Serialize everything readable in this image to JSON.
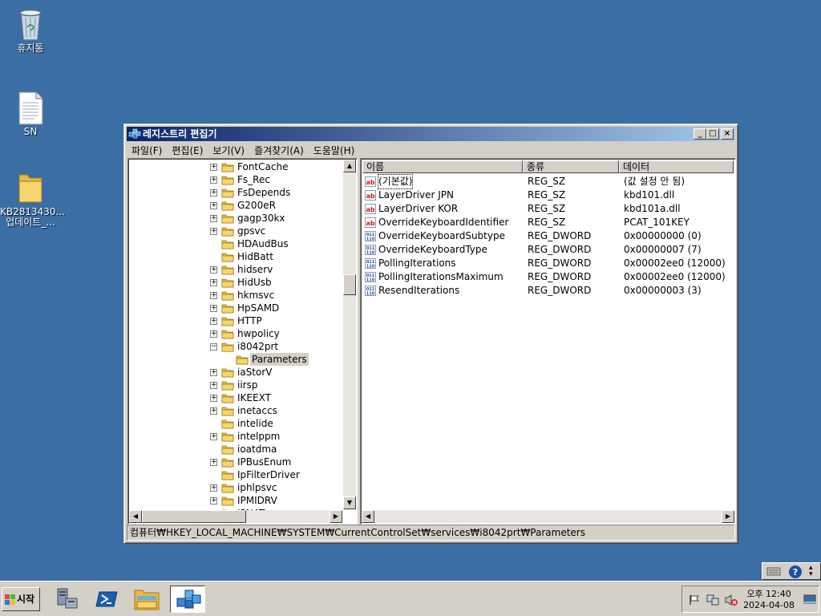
{
  "desktop": {
    "icons": [
      {
        "label": "휴지통",
        "icon": "recycle-bin-icon"
      },
      {
        "label": "SN",
        "icon": "text-file-icon"
      },
      {
        "label": "KB2813430...\n업데이트_...",
        "label1": "KB2813430...",
        "label2": "업데이트_...",
        "icon": "folder-icon"
      }
    ]
  },
  "window": {
    "title": "레지스트리 편집기",
    "menu": [
      "파일(F)",
      "편집(E)",
      "보기(V)",
      "즐겨찾기(A)",
      "도움말(H)"
    ]
  },
  "tree": {
    "items": [
      {
        "label": "FontCache",
        "expander": "+"
      },
      {
        "label": "Fs_Rec",
        "expander": "+"
      },
      {
        "label": "FsDepends",
        "expander": "+"
      },
      {
        "label": "G200eR",
        "expander": "+"
      },
      {
        "label": "gagp30kx",
        "expander": "+"
      },
      {
        "label": "gpsvc",
        "expander": "+"
      },
      {
        "label": "HDAudBus",
        "expander": ""
      },
      {
        "label": "HidBatt",
        "expander": ""
      },
      {
        "label": "hidserv",
        "expander": "+"
      },
      {
        "label": "HidUsb",
        "expander": "+"
      },
      {
        "label": "hkmsvc",
        "expander": "+"
      },
      {
        "label": "HpSAMD",
        "expander": "+"
      },
      {
        "label": "HTTP",
        "expander": "+"
      },
      {
        "label": "hwpolicy",
        "expander": "+"
      },
      {
        "label": "i8042prt",
        "expander": "−"
      },
      {
        "label": "Parameters",
        "expander": "",
        "child": true,
        "selected": true
      },
      {
        "label": "iaStorV",
        "expander": "+"
      },
      {
        "label": "iirsp",
        "expander": "+"
      },
      {
        "label": "IKEEXT",
        "expander": "+"
      },
      {
        "label": "inetaccs",
        "expander": "+"
      },
      {
        "label": "intelide",
        "expander": ""
      },
      {
        "label": "intelppm",
        "expander": "+"
      },
      {
        "label": "ioatdma",
        "expander": ""
      },
      {
        "label": "IPBusEnum",
        "expander": "+"
      },
      {
        "label": "IpFilterDriver",
        "expander": ""
      },
      {
        "label": "iphlpsvc",
        "expander": "+"
      },
      {
        "label": "IPMIDRV",
        "expander": "+"
      },
      {
        "label": "IPNAT",
        "expander": "+"
      }
    ]
  },
  "list": {
    "headers": [
      "이름",
      "종류",
      "데이터"
    ],
    "rows": [
      {
        "name": "(기본값)",
        "type": "REG_SZ",
        "data": "(값 설정 안 됨)",
        "icon": "string-value-icon"
      },
      {
        "name": "LayerDriver JPN",
        "type": "REG_SZ",
        "data": "kbd101.dll",
        "icon": "string-value-icon"
      },
      {
        "name": "LayerDriver KOR",
        "type": "REG_SZ",
        "data": "kbd101a.dll",
        "icon": "string-value-icon"
      },
      {
        "name": "OverrideKeyboardIdentifier",
        "type": "REG_SZ",
        "data": "PCAT_101KEY",
        "icon": "string-value-icon"
      },
      {
        "name": "OverrideKeyboardSubtype",
        "type": "REG_DWORD",
        "data": "0x00000000 (0)",
        "icon": "binary-value-icon"
      },
      {
        "name": "OverrideKeyboardType",
        "type": "REG_DWORD",
        "data": "0x00000007 (7)",
        "icon": "binary-value-icon"
      },
      {
        "name": "PollingIterations",
        "type": "REG_DWORD",
        "data": "0x00002ee0 (12000)",
        "icon": "binary-value-icon"
      },
      {
        "name": "PollingIterationsMaximum",
        "type": "REG_DWORD",
        "data": "0x00002ee0 (12000)",
        "icon": "binary-value-icon"
      },
      {
        "name": "ResendIterations",
        "type": "REG_DWORD",
        "data": "0x00000003 (3)",
        "icon": "binary-value-icon"
      }
    ]
  },
  "status": {
    "path": "컴퓨터₩HKEY_LOCAL_MACHINE₩SYSTEM₩CurrentControlSet₩services₩i8042prt₩Parameters"
  },
  "taskbar": {
    "start_label": "시작",
    "clock_time": "오후 12:40",
    "clock_date": "2024-04-08"
  }
}
